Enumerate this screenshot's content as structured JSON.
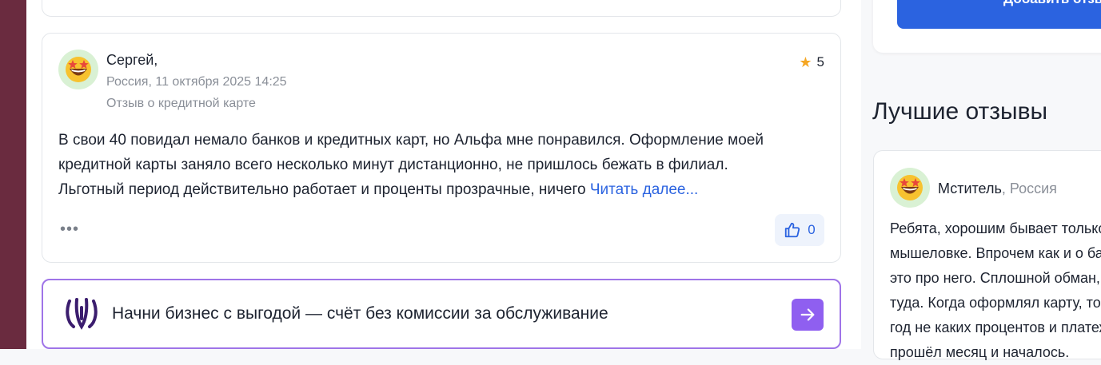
{
  "review": {
    "author": "Сергей,",
    "meta": "Россия, 11 октября 2025 14:25",
    "kind": "Отзыв о кредитной карте",
    "rating": "5",
    "text_lines": [
      "В свои 40 повидал немало банков и кредитных карт, но Альфа мне понравился. Оформление моей",
      "кредитной карты заняло всего несколько минут дистанционно, не пришлось бежать в филиал.",
      "Льготный период действительно работает и проценты прозрачные, ничего "
    ],
    "read_more": "Читать далее...",
    "more_dots": "•••",
    "likes": "0"
  },
  "promo": {
    "text": "Начни бизнес с выгодой — счёт без комиссии за обслуживание"
  },
  "sidebar": {
    "add_button": "Добавить отзыв",
    "best_title": "Лучшие отзывы",
    "best_review": {
      "author": "Мститель",
      "sep": ", ",
      "country": "Россия",
      "lines": [
        "Ребята, хорошим бывает только сыр в",
        "мышеловке. Впрочем как и о банке,",
        "это про него. Сплошной обман,",
        "туда. Когда оформлял карту, то",
        "год не каких процентов и платежей",
        "прошёл месяц и началось."
      ]
    }
  },
  "colors": {
    "accent": "#2b63e0",
    "promo_purple": "#8f5ff0",
    "star": "#f5a623",
    "left_strip": "#6a2b3f"
  },
  "icons": [
    "star-eyes-emoji",
    "star-icon",
    "thumbs-up-icon",
    "alfa-logo",
    "arrow-right-icon"
  ]
}
